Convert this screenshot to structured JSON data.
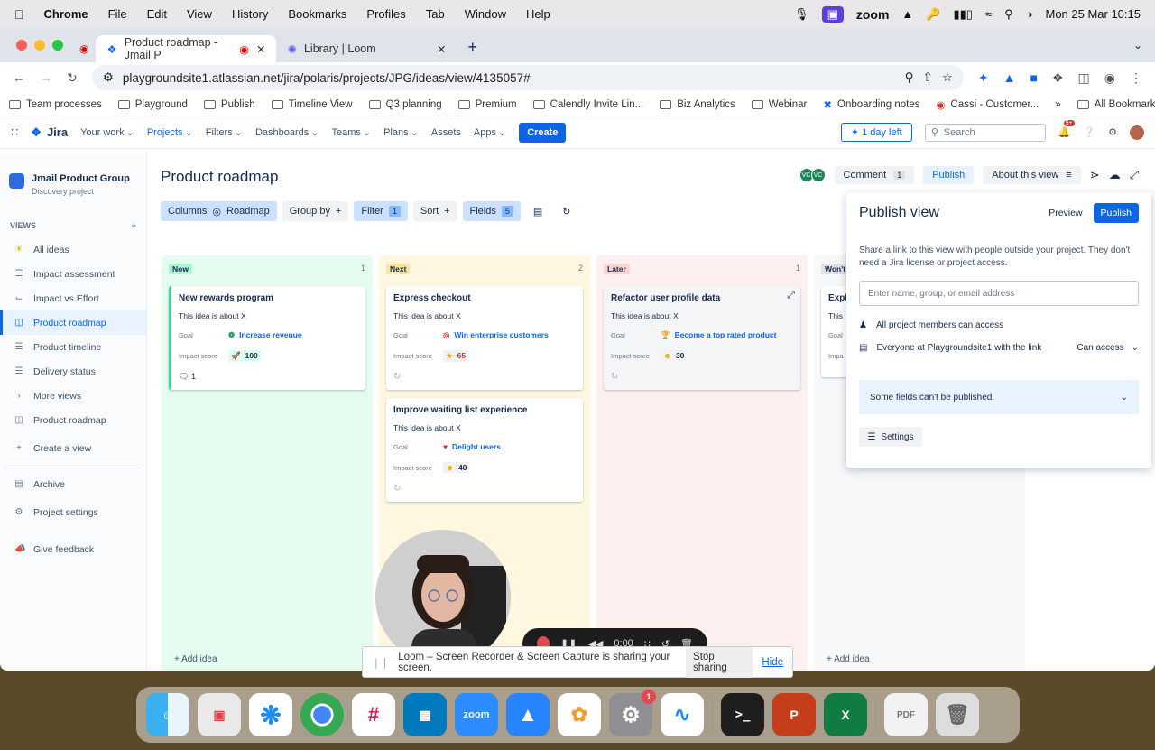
{
  "menubar": {
    "app": "Chrome",
    "menus": [
      "File",
      "Edit",
      "View",
      "History",
      "Bookmarks",
      "Profiles",
      "Tab",
      "Window",
      "Help"
    ],
    "zoom": "zoom",
    "datetime": "Mon 25 Mar  10:15"
  },
  "tabs": [
    {
      "title": "Product roadmap - Jmail P"
    },
    {
      "title": "Library | Loom"
    }
  ],
  "address": {
    "url": "playgroundsite1.atlassian.net/jira/polaris/projects/JPG/ideas/view/4135057#"
  },
  "bookmarks": [
    "Team processes",
    "Playground",
    "Publish",
    "Timeline View",
    "Q3 planning",
    "Premium",
    "Calendly Invite Lin...",
    "Biz Analytics",
    "Webinar",
    "Onboarding notes",
    "Cassi - Customer..."
  ],
  "bookmarks_all": "All Bookmarks",
  "jira_nav": {
    "logo": "Jira",
    "items": [
      "Your work",
      "Projects",
      "Filters",
      "Dashboards",
      "Teams",
      "Plans",
      "Assets",
      "Apps"
    ],
    "create": "Create",
    "trial": "1 day left",
    "search_placeholder": "Search",
    "notif": "9+"
  },
  "sidebar": {
    "project_name": "Jmail Product Group",
    "project_type": "Discovery project",
    "views_label": "VIEWS",
    "items": [
      {
        "label": "All ideas",
        "icon": "bulb-icon"
      },
      {
        "label": "Impact assessment",
        "icon": "list-icon"
      },
      {
        "label": "Impact vs Effort",
        "icon": "matrix-icon"
      },
      {
        "label": "Product roadmap",
        "icon": "board-icon"
      },
      {
        "label": "Product timeline",
        "icon": "timeline-icon"
      },
      {
        "label": "Delivery status",
        "icon": "list-icon"
      },
      {
        "label": "More views",
        "icon": "chevron-right-icon"
      },
      {
        "label": "Product roadmap",
        "icon": "board-icon"
      },
      {
        "label": "Create a view",
        "icon": "plus-icon"
      }
    ],
    "archive": "Archive",
    "settings": "Project settings",
    "feedback": "Give feedback"
  },
  "page": {
    "title": "Product roadmap",
    "comment": "Comment",
    "comment_count": "1",
    "publish": "Publish",
    "about": "About this view",
    "avatars": [
      "VC",
      "VC"
    ]
  },
  "toolbar": {
    "columns": "Columns",
    "roadmap": "Roadmap",
    "group_by": "Group by",
    "filter": "Filter",
    "filter_count": "1",
    "sort": "Sort",
    "fields": "Fields",
    "fields_count": "5"
  },
  "columns": [
    {
      "label": "Now",
      "count": "1",
      "color": "#e3fcef",
      "pill": "#abf5d1"
    },
    {
      "label": "Next",
      "count": "2",
      "color": "#fff7e0",
      "pill": "#f8e6a0"
    },
    {
      "label": "Later",
      "count": "1",
      "color": "#fdf0ef",
      "pill": "#ffd5d2"
    },
    {
      "label": "Won't",
      "count": "",
      "color": "#f7f8f9",
      "pill": "#dfe1e6"
    }
  ],
  "cards": [
    {
      "title": "New rewards program",
      "desc": "This idea is about X",
      "goal_label": "Goal",
      "goal": "Increase revenue",
      "score_label": "Impact score",
      "score": "100",
      "comments": "1"
    },
    {
      "title": "Express checkout",
      "desc": "This idea is about X",
      "goal_label": "Goal",
      "goal": "Win enterprise customers",
      "score_label": "Impact score",
      "score": "65"
    },
    {
      "title": "Improve waiting list experience",
      "desc": "This idea is about X",
      "goal_label": "Goal",
      "goal": "Delight users",
      "score_label": "Impact score",
      "score": "40"
    },
    {
      "title": "Refactor user profile data",
      "desc": "This idea is about X",
      "goal_label": "Goal",
      "goal": "Become a top rated product",
      "score_label": "Impact score",
      "score": "30"
    },
    {
      "title": "Expl",
      "desc": "This",
      "goal_label": "Goal",
      "score_label": "Impa"
    }
  ],
  "add_idea": "Add idea",
  "publish_panel": {
    "title": "Publish view",
    "preview": "Preview",
    "publish": "Publish",
    "desc": "Share a link to this view with people outside your project. They don't need a Jira license or project access.",
    "input_placeholder": "Enter name, group, or email address",
    "members": "All project members can access",
    "everyone": "Everyone at Playgroundsite1 with the link",
    "can_access": "Can access",
    "warning": "Some fields can't be published.",
    "settings": "Settings"
  },
  "recorder": {
    "time": "0:00"
  },
  "share_bar": {
    "text": "Loom – Screen Recorder & Screen Capture is sharing your screen.",
    "stop": "Stop sharing",
    "hide": "Hide"
  },
  "dock": {
    "zoom": "zoom",
    "settings_badge": "1"
  }
}
